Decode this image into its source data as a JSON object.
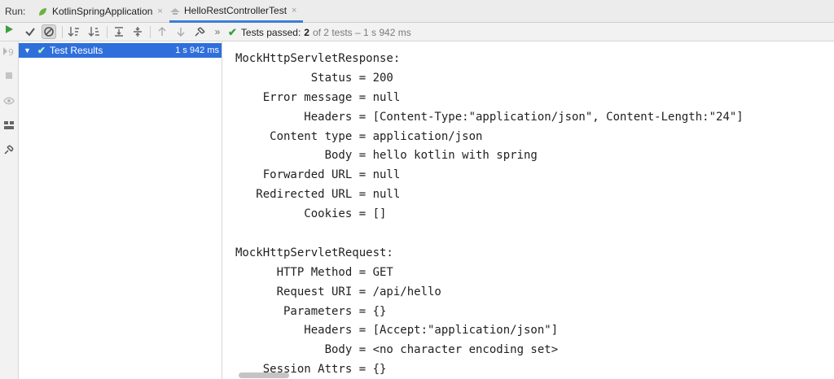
{
  "header": {
    "run_label": "Run:",
    "tabs": [
      {
        "label": "KotlinSpringApplication",
        "close": "×"
      },
      {
        "label": "HelloRestControllerTest",
        "close": "×"
      }
    ]
  },
  "toolbar": {
    "status_prefix": "Tests passed:",
    "status_count": "2",
    "status_detail": "of 2 tests – 1 s 942 ms",
    "overflow": "»"
  },
  "tree": {
    "root_label": "Test Results",
    "root_time": "1 s 942 ms"
  },
  "console": {
    "lines": [
      "MockHttpServletResponse:",
      "           Status = 200",
      "    Error message = null",
      "          Headers = [Content-Type:\"application/json\", Content-Length:\"24\"]",
      "     Content type = application/json",
      "             Body = hello kotlin with spring",
      "    Forwarded URL = null",
      "   Redirected URL = null",
      "          Cookies = []",
      "",
      "MockHttpServletRequest:",
      "      HTTP Method = GET",
      "      Request URI = /api/hello",
      "       Parameters = {}",
      "          Headers = [Accept:\"application/json\"]",
      "             Body = <no character encoding set>",
      "    Session Attrs = {}"
    ]
  },
  "colors": {
    "accent": "#3d7fd6",
    "selection": "#2f6fdc",
    "success": "#3e9e3e"
  }
}
